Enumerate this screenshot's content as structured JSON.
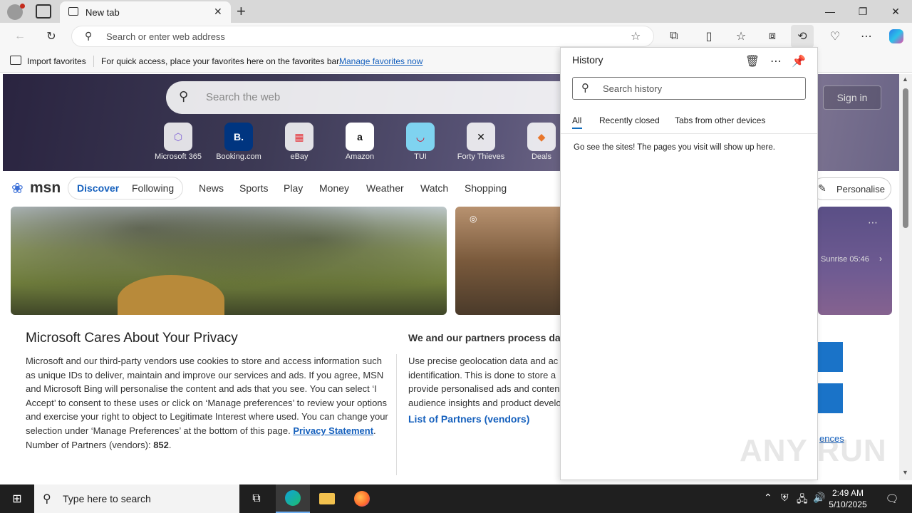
{
  "browser": {
    "tab_title": "New tab",
    "address_placeholder": "Search or enter web address"
  },
  "favorites_bar": {
    "import_label": "Import favorites",
    "message": "For quick access, place your favorites here on the favorites bar.",
    "manage_link": "Manage favorites now"
  },
  "newtab": {
    "search_placeholder": "Search the web",
    "sign_in": "Sign in",
    "tiles": [
      {
        "label": "Microsoft 365",
        "icon": "microsoft-365-icon"
      },
      {
        "label": "Booking.com",
        "icon": "booking-icon"
      },
      {
        "label": "eBay",
        "icon": "ebay-icon"
      },
      {
        "label": "Amazon",
        "icon": "amazon-icon"
      },
      {
        "label": "TUI",
        "icon": "tui-icon"
      },
      {
        "label": "Forty Thieves",
        "icon": "forty-thieves-icon"
      },
      {
        "label": "Deals",
        "icon": "deals-icon"
      }
    ],
    "msn": {
      "logo": "msn",
      "discover": "Discover",
      "following": "Following",
      "nav": [
        "News",
        "Sports",
        "Play",
        "Money",
        "Weather",
        "Watch",
        "Shopping"
      ],
      "personalise": "Personalise",
      "sunrise": "Sunrise 05:46"
    }
  },
  "privacy": {
    "title": "Microsoft Cares About Your Privacy",
    "body": "Microsoft and our third-party vendors use cookies to store and access information such as unique IDs to deliver, maintain and improve our services and ads. If you agree, MSN and Microsoft Bing will personalise the content and ads that you see. You can select ‘I Accept’ to consent to these uses or click on ‘Manage preferences’ to review your options and exercise your right to object to Legitimate Interest where used.  You can change your selection under ‘Manage Preferences’ at the bottom of this page.",
    "privacy_link": "Privacy Statement",
    "partners_label": "Number of Partners (vendors):",
    "partners_count": "852",
    "right_title": "We and our partners process data",
    "right_body_1": "Use precise geolocation data and ac",
    "right_body_2": "identification. This is done to store a",
    "right_body_3": "provide personalised ads and conten",
    "right_body_4": "audience insights and product develo",
    "vendors_link": "List of Partners (vendors)",
    "preferences_fragment": "ences"
  },
  "history": {
    "title": "History",
    "search_placeholder": "Search history",
    "tabs": [
      "All",
      "Recently closed",
      "Tabs from other devices"
    ],
    "empty_message": "Go see the sites! The pages you visit will show up here."
  },
  "taskbar": {
    "search_placeholder": "Type here to search",
    "time": "2:49 AM",
    "date": "5/10/2025"
  },
  "watermark": "ANY RUN"
}
